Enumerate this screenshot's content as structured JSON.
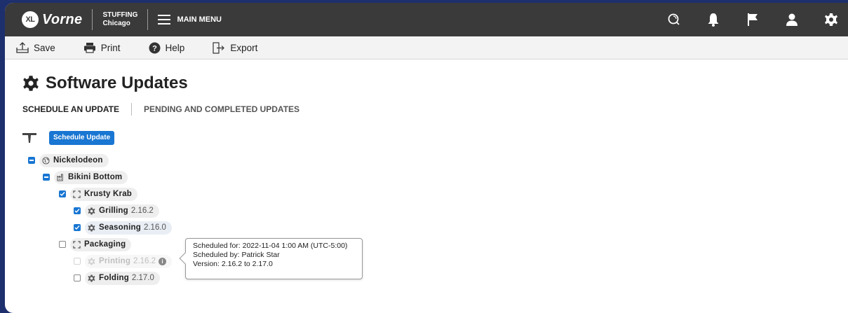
{
  "header": {
    "logo_badge": "XL",
    "logo_text": "Vorne",
    "location_line1": "STUFFING",
    "location_line2": "Chicago",
    "menu_label": "MAIN MENU",
    "icons": [
      "search-icon",
      "bell-icon",
      "flag-icon",
      "user-icon",
      "gear-icon"
    ]
  },
  "toolbar": {
    "save_label": "Save",
    "print_label": "Print",
    "help_label": "Help",
    "export_label": "Export"
  },
  "page": {
    "title": "Software Updates",
    "tabs": [
      {
        "label": "SCHEDULE AN UPDATE",
        "active": true
      },
      {
        "label": "PENDING AND COMPLETED UPDATES",
        "active": false
      }
    ],
    "schedule_button": "Schedule Update"
  },
  "tree": [
    {
      "label": "Nickelodeon",
      "version": "",
      "state": "partial",
      "icon": "globe-icon"
    },
    {
      "label": "Bikini Bottom",
      "version": "",
      "state": "partial",
      "icon": "factory-icon"
    },
    {
      "label": "Krusty Krab",
      "version": "",
      "state": "checked",
      "icon": "area-icon"
    },
    {
      "label": "Grilling",
      "version": "2.16.2",
      "state": "checked",
      "icon": "gear-icon"
    },
    {
      "label": "Seasoning",
      "version": "2.16.0",
      "state": "checked",
      "icon": "gear-icon"
    },
    {
      "label": "Packaging",
      "version": "",
      "state": "unchecked",
      "icon": "area-icon"
    },
    {
      "label": "Printing",
      "version": "2.16.2",
      "state": "disabled",
      "icon": "gear-icon"
    },
    {
      "label": "Folding",
      "version": "2.17.0",
      "state": "unchecked",
      "icon": "gear-icon"
    }
  ],
  "tooltip": {
    "line1": "Scheduled for: 2022-11-04 1:00 AM (UTC-5:00)",
    "line2": "Scheduled by: Patrick Star",
    "line3": "Version: 2.16.2 to 2.17.0"
  },
  "colors": {
    "background": "#1e2f6e",
    "topbar": "#3a3a3a",
    "accent": "#1976d2"
  }
}
